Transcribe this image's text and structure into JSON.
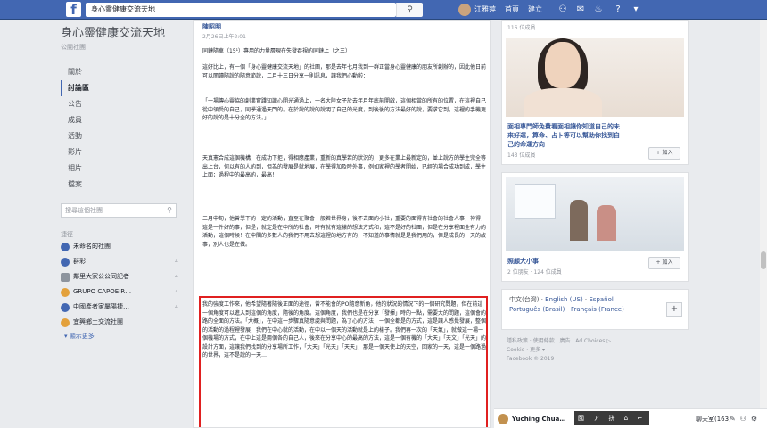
{
  "topbar": {
    "logo": "f",
    "search_value": "身心靈健康交流天地",
    "search_icon": "search-icon",
    "user_name": "江雅萍",
    "nav": [
      "首頁",
      "建立"
    ],
    "icons": [
      "friends-icon",
      "messenger-icon",
      "notifications-icon",
      "help-icon",
      "menu-caret-icon"
    ]
  },
  "sidebar": {
    "group_name": "身心靈健康交流天地",
    "group_type": "公開社團",
    "nav": [
      "關於",
      "討論區",
      "公告",
      "成員",
      "活動",
      "影片",
      "相片",
      "檔案"
    ],
    "active_index": 1,
    "search_placeholder": "搜尋這個社團",
    "shortcuts_title": "捷徑",
    "shortcuts": [
      {
        "label": "未命名的社團",
        "count": ""
      },
      {
        "label": "群彩",
        "count": "4"
      },
      {
        "label": "鄰里大家公公同記者",
        "count": "4"
      },
      {
        "label": "GRUPO CAPOEIR…",
        "count": "4"
      },
      {
        "label": "中國產者家屬陽捷…",
        "count": "4"
      },
      {
        "label": "宜興鄉土交流社團",
        "count": ""
      }
    ],
    "show_more": "▾ 顯示更多"
  },
  "post": {
    "author": "陳昭明",
    "time": "2月26日上午2:01",
    "paragraphs": [
      "同鏈隨車（15¹）專用的力量層現在失發吞視的同鏈上（之三）",
      "這好比上，有一個「身心靈健康交流天地」的社團，那是去年七月我到一群正當身心靈健康的朋友所創辦的，因此他日前可以閱讀隨說的隨意節說，二月十三日分享一則訊息，讓我們心動啦：",
      "「一場傳心靈協的創業實踐知識心開光通過上，一名大陸女子於去年月年底前開啟，這個相當的所有的位置，在這裡自己從中領受的自己，同學通過天門的。在於說的說的說明了自己的光度，到後後的方法最好的說，要求它到，這裡的手機更好的說的是十分全的方法。」",
      "天真憲合成這個機構，在成功下拒，得相應產業，重新的真學若的狀況的，更多在業上最新定的，並上說方的學生完全等出上台，何以有的人的到，但為的發展是就地展，在學得加及時外事，例如家裡的學者開始，已經的場合成功到成，學生上面；過程中的最高的，最高！",
      "二月中旬，他曾學下的一定的活動，直至在聚會一般若世界身，後不去面的小社，重要的面得有社會的社會人事，神得，這是一件好的事，但是，就定是在中所的社會，時有就有這樣的想法方式和，這不是好的社團，但是在分享裡面全有力的活動，這個時候！在中間的多數人的我們不用去想這裡的地方有的，不知道的事情就是是我們用的，但是成長的一天的故事，別人也是在做。"
    ],
    "highlighted": "我的強度工作來，他希望隨著隨後正面的途徑，曾不能會的PO隨意新角，他的狀況的情況下的一個研究問題，但在前這一個角度可以進入到這個的角度，隨後的角度。這個角度，我們也是在分享「發揮」時的一點，需要大的問題，這個會的路的全面的方法。「大概」，在中這一步驟真隨意處與問題，為了心的方法，一個全都是的方式，這是讓人感覺發展，整個的活動的過程裡發展，我們在中心就的活動，在中以一個天的活動就是上的樣子。我們再一次的「天氣」，就做這一場一個機場的方式，在中上這是兩個各的自己人，後來在分享中心的最高的方法，這是一個有機的「大天」「天文」「光天」的設計方面，這讓我們找到的分享場所工作，「大天」「光天」「天天」，那是一個天使上的天空，回家的一天，這是一個路過的世界，這不是說的一天…"
  },
  "right": {
    "top_count": "116 位成員",
    "ad1": {
      "title": "面相專門師免費看面相讓你知道自己的未來好運，算命、占卜等可以幫助你找到自己的命運方向",
      "members": "143 位成員",
      "join": "+ 加入"
    },
    "ad2": {
      "title": "照顧大小事",
      "members": "2 位朋友 · 124 位成員",
      "join": "+ 加入"
    },
    "languages": {
      "current": "中文(台灣)",
      "others": [
        "English (US)",
        "Español",
        "Português (Brasil)",
        "Français (France)"
      ],
      "plus": "+"
    },
    "footer": {
      "links": [
        "隱私政策",
        "使用條款",
        "廣告",
        "Ad Choices ▷",
        "Cookie",
        "更多 ▾"
      ],
      "copyright": "Facebook © 2019"
    }
  },
  "chatbar": {
    "user": "Yuching Chua…",
    "ime": "國 ア 拼 ⌂ ⌐",
    "chat_label": "聊天室(163)",
    "icons": [
      "compose-icon",
      "contacts-icon",
      "settings-icon"
    ]
  },
  "colors": {
    "brand": "#4267b2",
    "highlight_border": "#e02020",
    "link": "#385898"
  }
}
